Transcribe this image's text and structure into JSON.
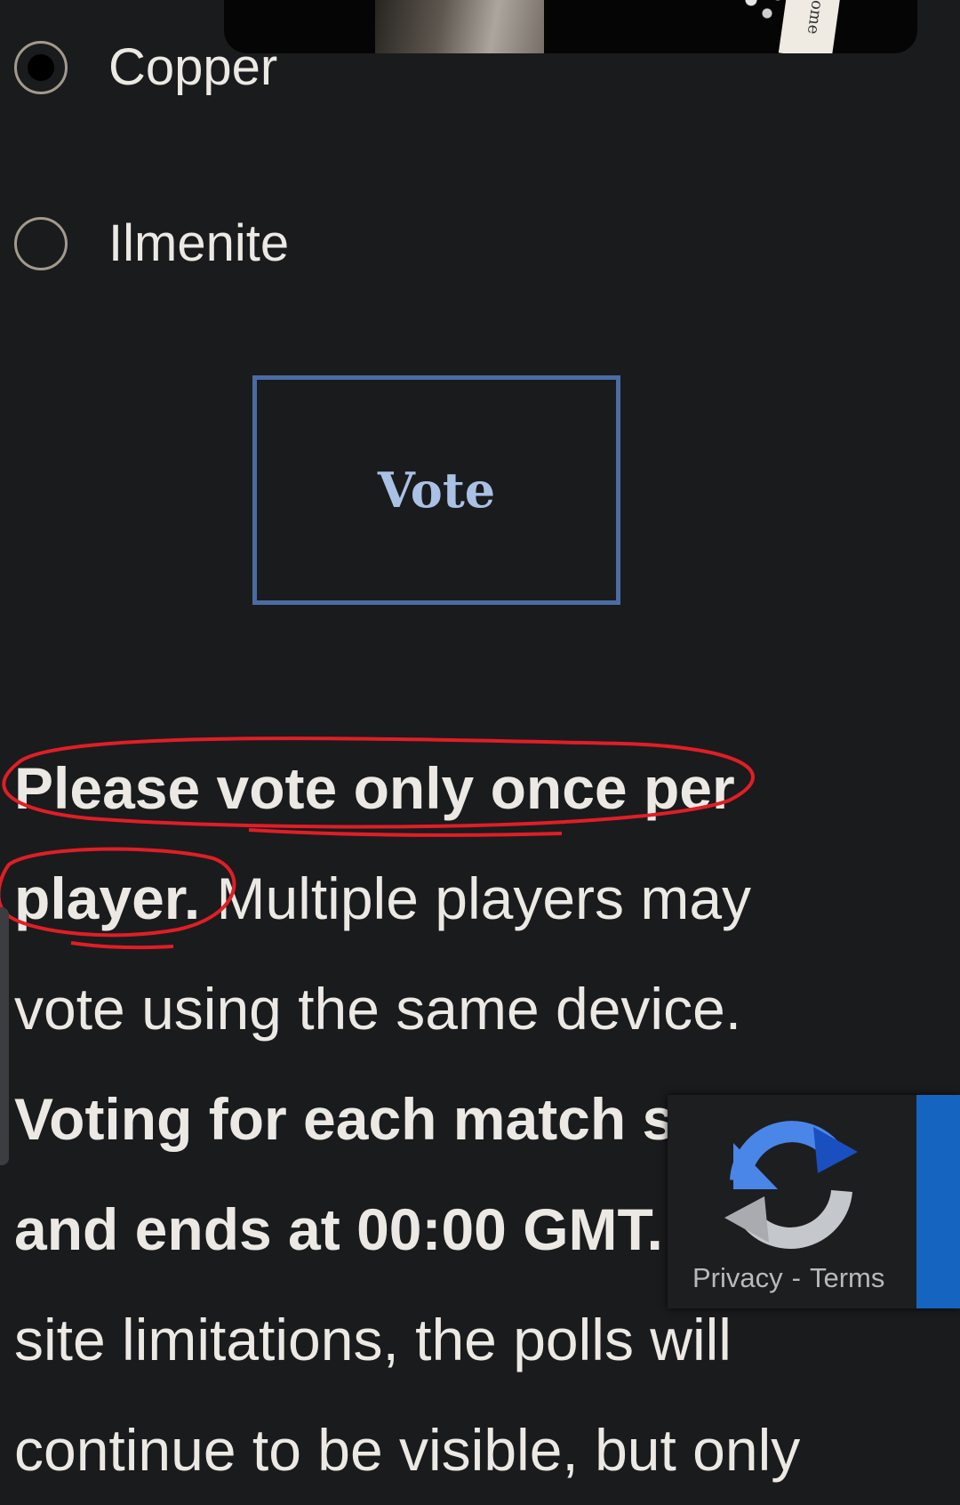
{
  "poll": {
    "options": [
      {
        "label": "Copper",
        "selected": true
      },
      {
        "label": "Ilmenite",
        "selected": false
      }
    ],
    "vote_label": "Vote"
  },
  "top_image": {
    "card_text": "come"
  },
  "notice": {
    "line1_bold": "Please vote only once per",
    "line2_bold": "player.",
    "line2_rest": " Multiple players may",
    "line3": "vote using the same device.",
    "line4_bold": "Voting for each match s",
    "line5_bold": "and ends at 00:00 GMT.",
    "line6": "site limitations, the polls will",
    "line7": "continue to be visible, but only"
  },
  "recaptcha": {
    "privacy_label": "Privacy",
    "separator": "-",
    "terms_label": "Terms"
  },
  "colors": {
    "background": "#1a1b1d",
    "text": "#ece9e4",
    "vote_border": "#4b6ca3",
    "vote_text": "#a9c1e4",
    "annotation_red": "#e01e26",
    "recaptcha_blue": "#1565c0"
  }
}
